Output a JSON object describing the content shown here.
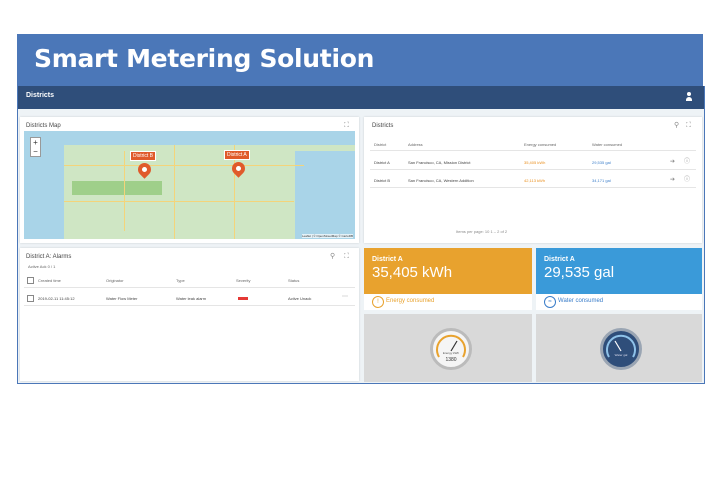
{
  "slide": {
    "title": "Smart Metering Solution"
  },
  "app": {
    "title": "Districts"
  },
  "map_card": {
    "title": "Districts Map",
    "zoom_in": "+",
    "zoom_out": "−",
    "markers": [
      "District B",
      "District A"
    ],
    "credit": "Leaflet | © OpenStreetMap © CartoDB"
  },
  "districts_card": {
    "title": "Districts",
    "columns": [
      "District",
      "Address",
      "Energy consumed",
      "Water consumed"
    ],
    "rows": [
      {
        "district": "District A",
        "address": "San Francisco, CA, Mission District",
        "energy": "35,405 kWh",
        "water": "29,535 gal"
      },
      {
        "district": "District B",
        "address": "San Francisco, CA, Western Addition",
        "energy": "42,113 kWh",
        "water": "34,171 gal"
      }
    ],
    "pager": "Items per page: 10  1 – 2 of 2"
  },
  "alarms_card": {
    "title": "District A: Alarms",
    "filter": "Active  Ack 0 / 1",
    "columns": [
      "Created time",
      "Originator",
      "Type",
      "Severity",
      "Status"
    ],
    "rows": [
      {
        "created": "2019-02-11 11:45:12",
        "originator": "Water Flow Meter",
        "type": "Water leak alarm",
        "severity": "",
        "status": "Active Unack"
      }
    ]
  },
  "tiles": {
    "energy": {
      "label": "District A",
      "value": "35,405 kWh",
      "foot": "Energy consumed",
      "color": "#e8a22e"
    },
    "water": {
      "label": "District A",
      "value": "29,535 gal",
      "foot": "Water consumed",
      "color": "#3a9ad9"
    },
    "gauge_energy": {
      "caption": "Energy kWh",
      "readout": "1380"
    },
    "gauge_water": {
      "caption": "Water gal"
    }
  },
  "colors": {
    "title_bar": "#4b77b8",
    "app_bar": "#2f4e7a",
    "marker": "#e05a2b"
  }
}
